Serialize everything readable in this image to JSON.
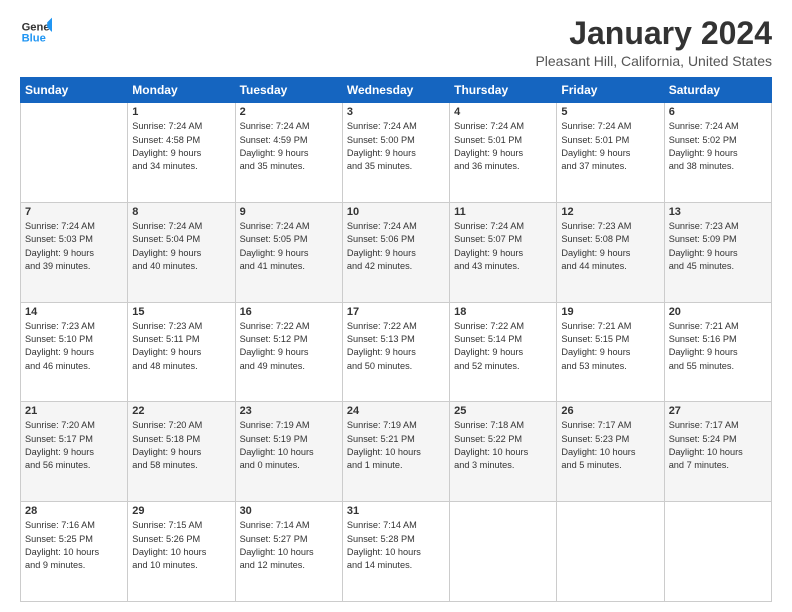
{
  "logo": {
    "line1": "General",
    "line2": "Blue"
  },
  "title": "January 2024",
  "subtitle": "Pleasant Hill, California, United States",
  "days_of_week": [
    "Sunday",
    "Monday",
    "Tuesday",
    "Wednesday",
    "Thursday",
    "Friday",
    "Saturday"
  ],
  "weeks": [
    [
      {
        "day": "",
        "info": ""
      },
      {
        "day": "1",
        "info": "Sunrise: 7:24 AM\nSunset: 4:58 PM\nDaylight: 9 hours\nand 34 minutes."
      },
      {
        "day": "2",
        "info": "Sunrise: 7:24 AM\nSunset: 4:59 PM\nDaylight: 9 hours\nand 35 minutes."
      },
      {
        "day": "3",
        "info": "Sunrise: 7:24 AM\nSunset: 5:00 PM\nDaylight: 9 hours\nand 35 minutes."
      },
      {
        "day": "4",
        "info": "Sunrise: 7:24 AM\nSunset: 5:01 PM\nDaylight: 9 hours\nand 36 minutes."
      },
      {
        "day": "5",
        "info": "Sunrise: 7:24 AM\nSunset: 5:01 PM\nDaylight: 9 hours\nand 37 minutes."
      },
      {
        "day": "6",
        "info": "Sunrise: 7:24 AM\nSunset: 5:02 PM\nDaylight: 9 hours\nand 38 minutes."
      }
    ],
    [
      {
        "day": "7",
        "info": "Sunrise: 7:24 AM\nSunset: 5:03 PM\nDaylight: 9 hours\nand 39 minutes."
      },
      {
        "day": "8",
        "info": "Sunrise: 7:24 AM\nSunset: 5:04 PM\nDaylight: 9 hours\nand 40 minutes."
      },
      {
        "day": "9",
        "info": "Sunrise: 7:24 AM\nSunset: 5:05 PM\nDaylight: 9 hours\nand 41 minutes."
      },
      {
        "day": "10",
        "info": "Sunrise: 7:24 AM\nSunset: 5:06 PM\nDaylight: 9 hours\nand 42 minutes."
      },
      {
        "day": "11",
        "info": "Sunrise: 7:24 AM\nSunset: 5:07 PM\nDaylight: 9 hours\nand 43 minutes."
      },
      {
        "day": "12",
        "info": "Sunrise: 7:23 AM\nSunset: 5:08 PM\nDaylight: 9 hours\nand 44 minutes."
      },
      {
        "day": "13",
        "info": "Sunrise: 7:23 AM\nSunset: 5:09 PM\nDaylight: 9 hours\nand 45 minutes."
      }
    ],
    [
      {
        "day": "14",
        "info": "Sunrise: 7:23 AM\nSunset: 5:10 PM\nDaylight: 9 hours\nand 46 minutes."
      },
      {
        "day": "15",
        "info": "Sunrise: 7:23 AM\nSunset: 5:11 PM\nDaylight: 9 hours\nand 48 minutes."
      },
      {
        "day": "16",
        "info": "Sunrise: 7:22 AM\nSunset: 5:12 PM\nDaylight: 9 hours\nand 49 minutes."
      },
      {
        "day": "17",
        "info": "Sunrise: 7:22 AM\nSunset: 5:13 PM\nDaylight: 9 hours\nand 50 minutes."
      },
      {
        "day": "18",
        "info": "Sunrise: 7:22 AM\nSunset: 5:14 PM\nDaylight: 9 hours\nand 52 minutes."
      },
      {
        "day": "19",
        "info": "Sunrise: 7:21 AM\nSunset: 5:15 PM\nDaylight: 9 hours\nand 53 minutes."
      },
      {
        "day": "20",
        "info": "Sunrise: 7:21 AM\nSunset: 5:16 PM\nDaylight: 9 hours\nand 55 minutes."
      }
    ],
    [
      {
        "day": "21",
        "info": "Sunrise: 7:20 AM\nSunset: 5:17 PM\nDaylight: 9 hours\nand 56 minutes."
      },
      {
        "day": "22",
        "info": "Sunrise: 7:20 AM\nSunset: 5:18 PM\nDaylight: 9 hours\nand 58 minutes."
      },
      {
        "day": "23",
        "info": "Sunrise: 7:19 AM\nSunset: 5:19 PM\nDaylight: 10 hours\nand 0 minutes."
      },
      {
        "day": "24",
        "info": "Sunrise: 7:19 AM\nSunset: 5:21 PM\nDaylight: 10 hours\nand 1 minute."
      },
      {
        "day": "25",
        "info": "Sunrise: 7:18 AM\nSunset: 5:22 PM\nDaylight: 10 hours\nand 3 minutes."
      },
      {
        "day": "26",
        "info": "Sunrise: 7:17 AM\nSunset: 5:23 PM\nDaylight: 10 hours\nand 5 minutes."
      },
      {
        "day": "27",
        "info": "Sunrise: 7:17 AM\nSunset: 5:24 PM\nDaylight: 10 hours\nand 7 minutes."
      }
    ],
    [
      {
        "day": "28",
        "info": "Sunrise: 7:16 AM\nSunset: 5:25 PM\nDaylight: 10 hours\nand 9 minutes."
      },
      {
        "day": "29",
        "info": "Sunrise: 7:15 AM\nSunset: 5:26 PM\nDaylight: 10 hours\nand 10 minutes."
      },
      {
        "day": "30",
        "info": "Sunrise: 7:14 AM\nSunset: 5:27 PM\nDaylight: 10 hours\nand 12 minutes."
      },
      {
        "day": "31",
        "info": "Sunrise: 7:14 AM\nSunset: 5:28 PM\nDaylight: 10 hours\nand 14 minutes."
      },
      {
        "day": "",
        "info": ""
      },
      {
        "day": "",
        "info": ""
      },
      {
        "day": "",
        "info": ""
      }
    ]
  ]
}
